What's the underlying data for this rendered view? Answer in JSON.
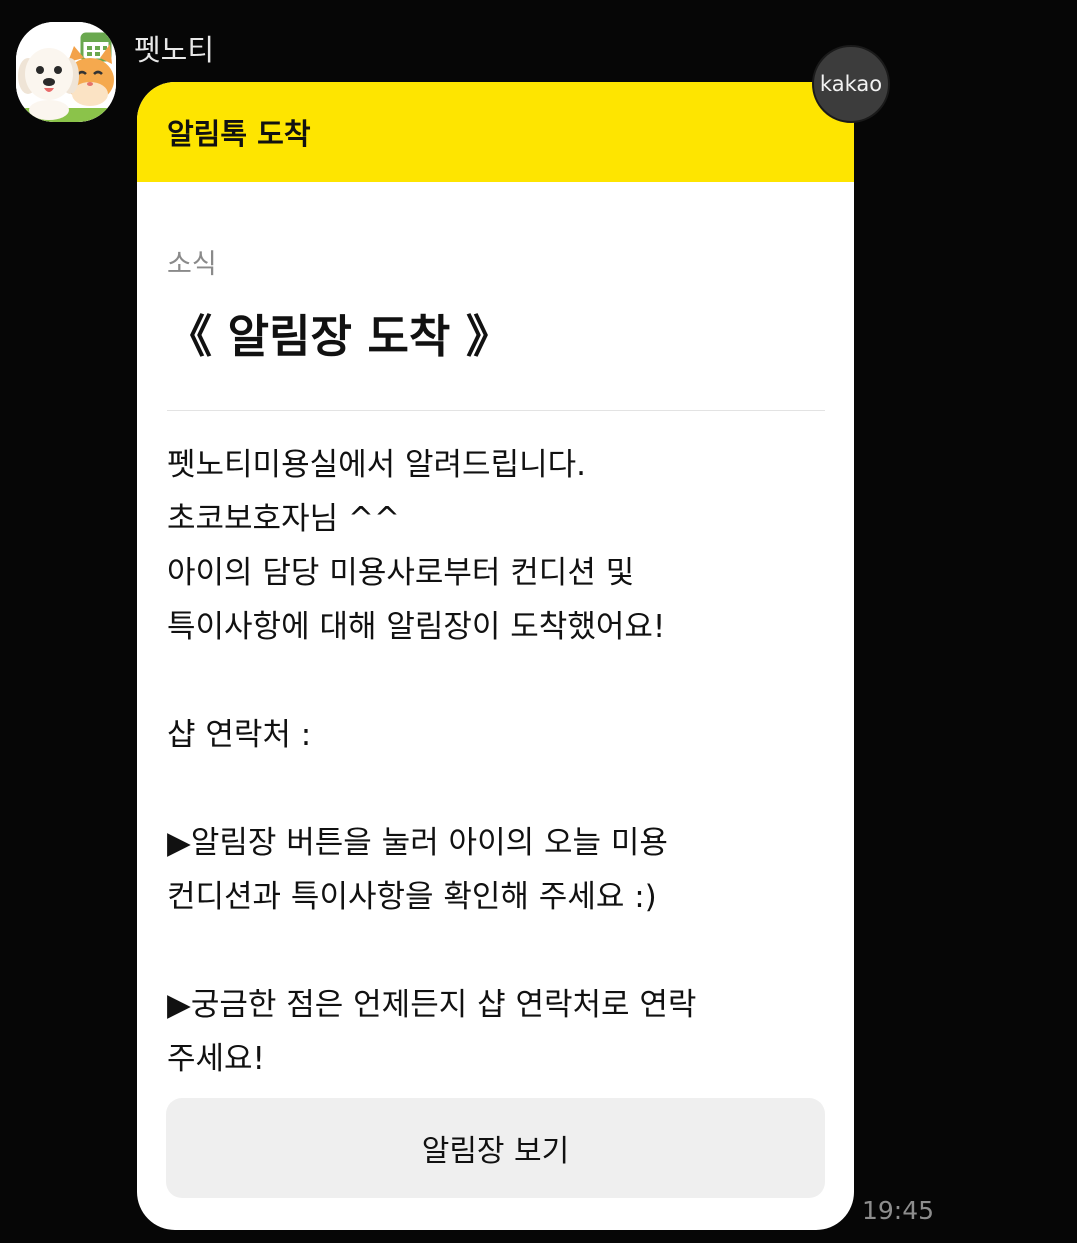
{
  "chat": {
    "sender_name": "펫노티",
    "timestamp": "19:45",
    "badge_label": "kakao",
    "avatar_icon": "dog-and-cat-calendar-icon"
  },
  "message": {
    "header_title": "알림톡 도착",
    "subtitle": "소식",
    "headline": "《 알림장 도착 》",
    "lines": [
      "펫노티미용실에서 알려드립니다.",
      "초코보호자님 ^^",
      "아이의 담당 미용사로부터 컨디션 및",
      "특이사항에 대해 알림장이 도착했어요!",
      "",
      "샵 연락처 :",
      "",
      "▶알림장 버튼을 눌러 아이의 오늘 미용",
      "컨디션과 특이사항을 확인해 주세요 :)",
      "",
      "▶궁금한 점은 언제든지 샵 연락처로 연락",
      "주세요!"
    ],
    "button_label": "알림장 보기"
  },
  "colors": {
    "header_yellow": "#fee500",
    "background": "#060606",
    "button_bg": "#efefef"
  }
}
